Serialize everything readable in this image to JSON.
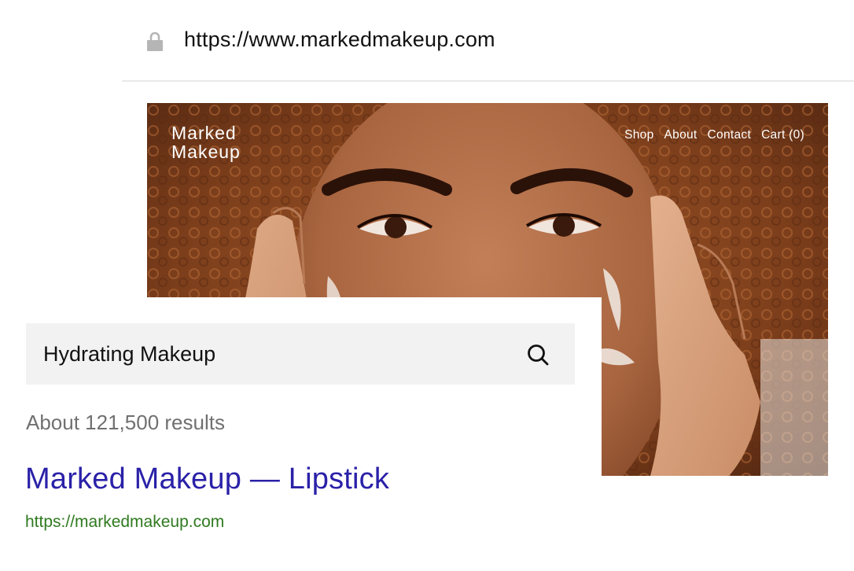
{
  "browser": {
    "url": "https://www.markedmakeup.com",
    "lock_icon": "lock-icon"
  },
  "site": {
    "logo_line1": "Marked",
    "logo_line2": "Makeup",
    "nav": [
      "Shop",
      "About",
      "Contact",
      "Cart (0)"
    ],
    "hero_image": "woman-with-curly-hair-applying-face-cream-photo"
  },
  "search": {
    "query": "Hydrating Makeup",
    "icon": "search-icon",
    "result_count": "About 121,500 results",
    "result": {
      "title": "Marked Makeup — Lipstick",
      "url": "https://markedmakeup.com"
    }
  },
  "colors": {
    "result_title": "#2a21a8",
    "result_url": "#2f7a1f",
    "result_count": "#707070",
    "search_box_bg": "#f2f2f2"
  }
}
